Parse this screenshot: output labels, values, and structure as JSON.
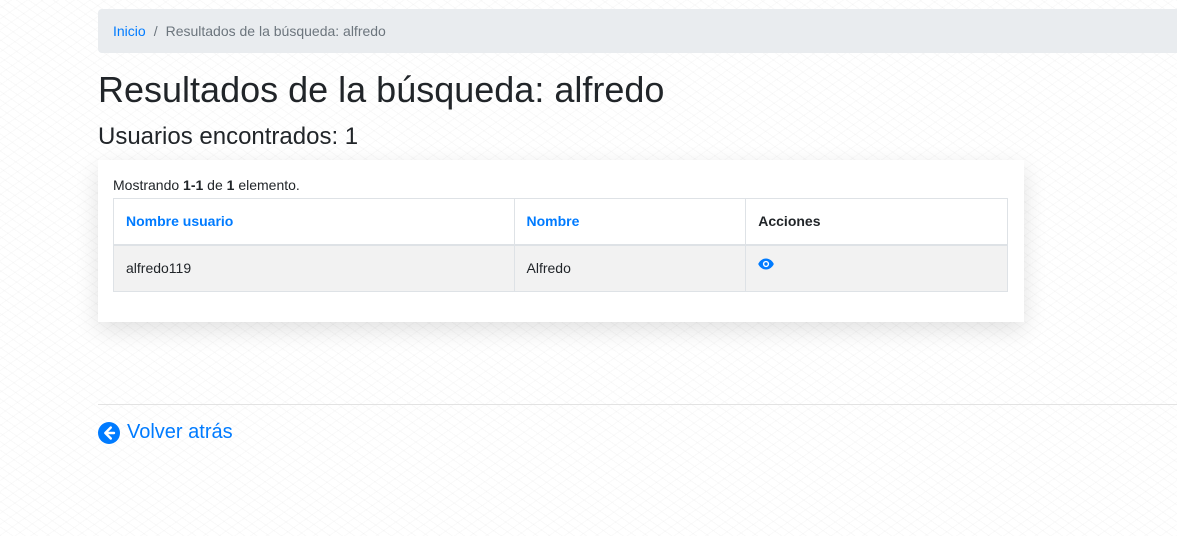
{
  "breadcrumb": {
    "home": "Inicio",
    "separator": "/",
    "current": "Resultados de la búsqueda: alfredo"
  },
  "page": {
    "title": "Resultados de la búsqueda: alfredo",
    "subtitle": "Usuarios encontrados: 1"
  },
  "summary": {
    "prefix": "Mostrando ",
    "range": "1-1",
    "middle": " de ",
    "total": "1",
    "suffix": " elemento."
  },
  "table": {
    "headers": {
      "username": "Nombre usuario",
      "name": "Nombre",
      "actions": "Acciones"
    },
    "rows": [
      {
        "username": "alfredo119",
        "name": "Alfredo",
        "action_icon": "eye-icon"
      }
    ]
  },
  "footer": {
    "back_label": "Volver atrás",
    "back_icon": "arrow-circle-left-icon"
  },
  "colors": {
    "accent": "#007bff",
    "breadcrumb_bg": "#e9ecef",
    "row_bg": "#f2f2f2"
  }
}
